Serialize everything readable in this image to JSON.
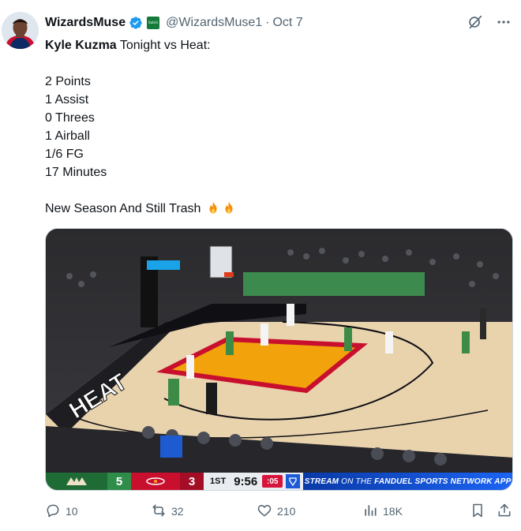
{
  "author": {
    "display_name": "WizardsMuse",
    "affiliate_badge_text": "Kalshi",
    "handle": "@WizardsMuse1",
    "separator": "·",
    "date": "Oct 7"
  },
  "tweet": {
    "lines": [
      {
        "bold": "Kyle Kuzma",
        "rest": " Tonight vs Heat:"
      },
      {
        "text": "2 Points"
      },
      {
        "text": "1 Assist"
      },
      {
        "text": "0 Threes"
      },
      {
        "text": "1 Airball"
      },
      {
        "text": "1/6 FG"
      },
      {
        "text": "17 Minutes"
      },
      {
        "text": "New Season And Still Trash"
      }
    ],
    "emojis": [
      "fire-emoji",
      "fire-emoji"
    ]
  },
  "media": {
    "court_text": "HEAT",
    "scoreboard": {
      "away_score": "5",
      "home_score": "3",
      "quarter": "1ST",
      "clock": "9:56",
      "shot_clock": ":05",
      "stream_text_strong": "STREAM",
      "stream_text_light": "ON THE",
      "stream_text_rest": "FANDUEL SPORTS NETWORK APP"
    }
  },
  "actions": {
    "replies": "10",
    "reposts": "32",
    "likes": "210",
    "views": "18K"
  },
  "colors": {
    "accent": "#1d9bf0",
    "muted": "#536471",
    "bucks_green": "#1f6b35",
    "heat_red": "#c8102e"
  }
}
